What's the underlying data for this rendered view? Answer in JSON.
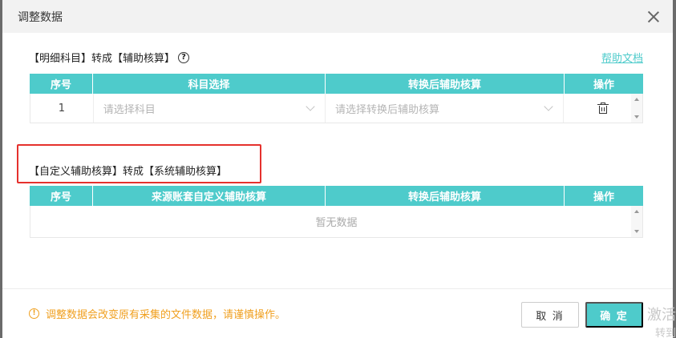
{
  "dialog": {
    "title": "调整数据"
  },
  "section1": {
    "title": "【明细科目】转成【辅助核算】",
    "help_link": "帮助文档",
    "columns": [
      "序号",
      "科目选择",
      "转换后辅助核算",
      "操作"
    ],
    "row": {
      "index": "1",
      "subject_placeholder": "请选择科目",
      "aux_placeholder": "请选择转换后辅助核算"
    }
  },
  "section2": {
    "title": "【自定义辅助核算】转成【系统辅助核算】",
    "columns": [
      "序号",
      "来源账套自定义辅助核算",
      "转换后辅助核算",
      "操作"
    ],
    "empty_text": "暂无数据"
  },
  "footer": {
    "warning": "调整数据会改变原有采集的文件数据，请谨慎操作。",
    "cancel_label": "取 消",
    "ok_label": "确 定"
  },
  "watermark": {
    "line1": "激活",
    "line2": "转到"
  },
  "colors": {
    "accent": "#4ecbcb",
    "warning": "#f0a020",
    "highlight": "#e5312d"
  }
}
